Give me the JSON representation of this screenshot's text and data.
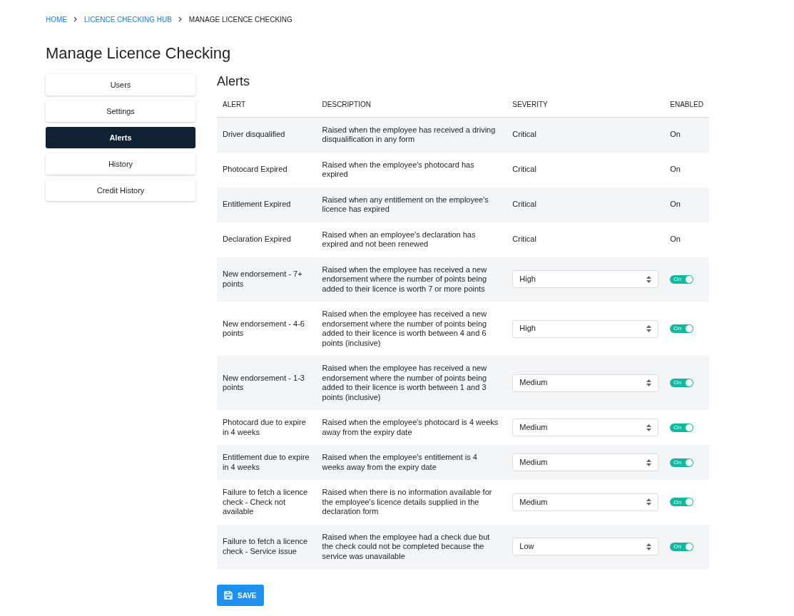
{
  "breadcrumbs": [
    {
      "label": "HOME",
      "link": true
    },
    {
      "label": "LICENCE CHECKING HUB",
      "link": true
    },
    {
      "label": "MANAGE LICENCE CHECKING",
      "link": false
    }
  ],
  "page_title": "Manage Licence Checking",
  "sidebar": {
    "items": [
      {
        "label": "Users",
        "selected": false
      },
      {
        "label": "Settings",
        "selected": false
      },
      {
        "label": "Alerts",
        "selected": true
      },
      {
        "label": "History",
        "selected": false
      },
      {
        "label": "Credit History",
        "selected": false
      }
    ]
  },
  "section_title": "Alerts",
  "table": {
    "columns": [
      "ALERT",
      "DESCRIPTION",
      "SEVERITY",
      "ENABLED"
    ],
    "rows": [
      {
        "kind": "fixed",
        "alert": "Driver disqualified",
        "description": "Raised when the employee has received a driving disqualification in any form",
        "severity": "Critical",
        "enabled": "On"
      },
      {
        "kind": "fixed",
        "alert": "Photocard Expired",
        "description": "Raised when the employee's photocard has expired",
        "severity": "Critical",
        "enabled": "On"
      },
      {
        "kind": "fixed",
        "alert": "Entitlement Expired",
        "description": "Raised when any entitlement on the employee's licence has expired",
        "severity": "Critical",
        "enabled": "On"
      },
      {
        "kind": "fixed",
        "alert": "Declaration Expired",
        "description": "Raised when an employee's declaration has expired and not been renewed",
        "severity": "Critical",
        "enabled": "On"
      },
      {
        "kind": "editable",
        "alert": "New endorsement - 7+ points",
        "description": "Raised when the employee has received a new endorsement where the number of points being added to their licence is worth 7 or more points",
        "severity": "High",
        "enabled": "On",
        "on": true
      },
      {
        "kind": "editable",
        "alert": "New endorsement - 4-6 points",
        "description": "Raised when the employee has received a new endorsement where the number of points being added to their licence is worth between 4 and 6 points (inclusive)",
        "severity": "High",
        "enabled": "On",
        "on": true
      },
      {
        "kind": "editable",
        "alert": "New endorsement - 1-3 points",
        "description": "Raised when the employee has received a new endorsement where the number of points being added to their licence is worth between 1 and 3 points (inclusive)",
        "severity": "Medium",
        "enabled": "On",
        "on": true
      },
      {
        "kind": "editable",
        "alert": "Photocard due to expire in 4 weeks",
        "description": "Raised when the employee's photocard is 4 weeks away from the expiry date",
        "severity": "Medium",
        "enabled": "On",
        "on": true
      },
      {
        "kind": "editable",
        "alert": "Entitlement due to expire in 4 weeks",
        "description": "Raised when the employee's entitlement is 4 weeks away from the expiry date",
        "severity": "Medium",
        "enabled": "On",
        "on": true
      },
      {
        "kind": "editable",
        "alert": "Failure to fetch a licence check - Check not available",
        "description": "Raised when there is no information available for the employee's licence details supplied in the declaration form",
        "severity": "Medium",
        "enabled": "On",
        "on": true
      },
      {
        "kind": "editable",
        "alert": "Failure to fetch a licence check - Service issue",
        "description": "Raised when the employee had a check due but the check could not be completed because the service was unavailable",
        "severity": "Low",
        "enabled": "On",
        "on": true
      }
    ]
  },
  "save_button": "SAVE"
}
